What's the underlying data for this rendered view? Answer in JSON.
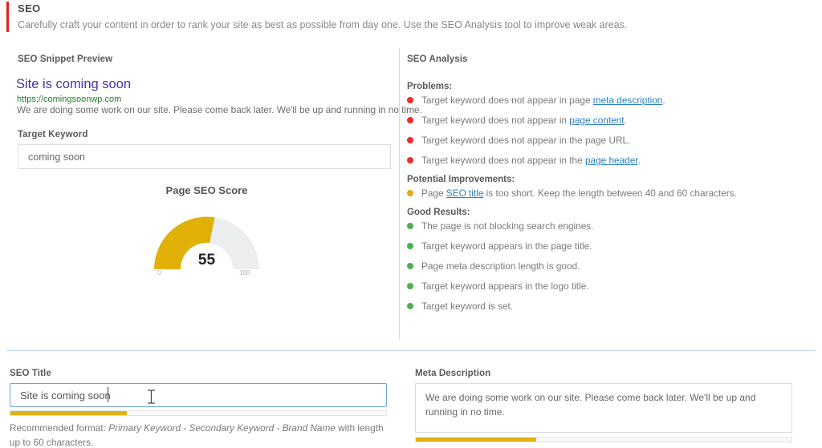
{
  "header": {
    "title": "SEO",
    "description": "Carefully craft your content in order to rank your site as best as possible from day one. Use the SEO Analysis tool to improve weak areas.",
    "accent_color": "#e02020"
  },
  "snippet": {
    "section_label": "SEO Snippet Preview",
    "title": "Site is coming soon",
    "url": "https://comingsoonwp.com",
    "description": "We are doing some work on our site. Please come back later. We'll be up and running in no time.",
    "title_color": "#4b2fa8",
    "url_color": "#2a7a2a"
  },
  "target_keyword": {
    "label": "Target Keyword",
    "value": "coming soon",
    "placeholder": "Target Keyword"
  },
  "gauge": {
    "title": "Page SEO Score",
    "value": "55",
    "min_label": "0",
    "max_label": "100",
    "fill_color": "#e0b006",
    "track_color": "#eceef0"
  },
  "analysis": {
    "section_label": "SEO Analysis",
    "groups": [
      {
        "heading": "Problems:",
        "severity": "red",
        "items": [
          {
            "before": "Target keyword does not appear in page ",
            "link": "meta description",
            "after": "."
          },
          {
            "before": "Target keyword does not appear in ",
            "link": "page content",
            "after": "."
          },
          {
            "before": "Target keyword does not appear in the page URL.",
            "link": "",
            "after": ""
          },
          {
            "before": "Target keyword does not appear in the ",
            "link": "page header",
            "after": "."
          }
        ]
      },
      {
        "heading": "Potential Improvements:",
        "severity": "amber",
        "items": [
          {
            "before": "Page ",
            "link": "SEO title",
            "after": " is too short. Keep the length between 40 and 60 characters."
          }
        ]
      },
      {
        "heading": "Good Results:",
        "severity": "green",
        "items": [
          {
            "before": "The page is not blocking search engines.",
            "link": "",
            "after": ""
          },
          {
            "before": "Target keyword appears in the page title.",
            "link": "",
            "after": ""
          },
          {
            "before": "Page meta description length is good.",
            "link": "",
            "after": ""
          },
          {
            "before": "Target keyword appears in the logo title.",
            "link": "",
            "after": ""
          },
          {
            "before": "Target keyword is set.",
            "link": "",
            "after": ""
          }
        ]
      }
    ],
    "link_color": "#2a7fbb"
  },
  "seo_title": {
    "label": "SEO Title",
    "value": "Site is coming soon",
    "placeholder": "SEO Title",
    "progress_percent": 31,
    "help_before": "Recommended format: ",
    "help_emphasis": "Primary Keyword - Secondary Keyword - Brand Name",
    "help_after": " with length up to 60 characters."
  },
  "meta_description": {
    "label": "Meta Description",
    "value": "We are doing some work on our site. Please come back later. We'll be up and running in no time.",
    "placeholder": "Meta Description",
    "progress_percent": 32
  },
  "colors": {
    "bar_fill": "#e2b213",
    "focus_border": "#6aa3d5",
    "divider": "#bfd4e4"
  }
}
